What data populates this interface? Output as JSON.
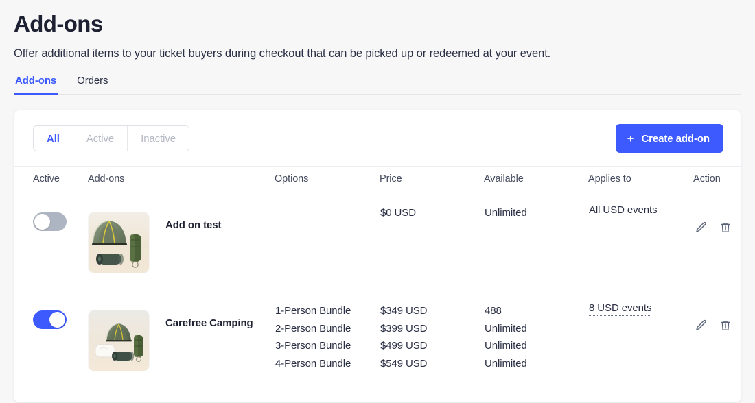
{
  "page": {
    "title": "Add-ons",
    "subtitle": "Offer additional items to your ticket buyers during checkout that can be picked up or redeemed at your event."
  },
  "tabs": [
    {
      "label": "Add-ons",
      "active": true
    },
    {
      "label": "Orders",
      "active": false
    }
  ],
  "toolbar": {
    "filters": [
      {
        "label": "All",
        "selected": true
      },
      {
        "label": "Active",
        "selected": false
      },
      {
        "label": "Inactive",
        "selected": false
      }
    ],
    "create_label": "Create add-on",
    "create_icon": "plus-icon",
    "plus_glyph": "+"
  },
  "table": {
    "headers": {
      "active": "Active",
      "addons": "Add-ons",
      "options": "Options",
      "price": "Price",
      "available": "Available",
      "applies_to": "Applies to",
      "action": "Action"
    },
    "rows": [
      {
        "active": false,
        "name": "Add on test",
        "thumbnail": "camping-gear-photo",
        "options": [],
        "prices": [
          "$0 USD"
        ],
        "available": [
          "Unlimited"
        ],
        "applies_to": "All USD events",
        "applies_to_link": false,
        "edit_icon": "pencil-icon",
        "delete_icon": "trash-icon"
      },
      {
        "active": true,
        "name": "Carefree Camping",
        "thumbnail": "camping-gear-wide-photo",
        "options": [
          "1-Person Bundle",
          "2-Person Bundle",
          "3-Person Bundle",
          "4-Person Bundle"
        ],
        "prices": [
          "$349 USD",
          "$399 USD",
          "$499 USD",
          "$549 USD"
        ],
        "available": [
          "488",
          "Unlimited",
          "Unlimited",
          "Unlimited"
        ],
        "applies_to": "8 USD events",
        "applies_to_link": true,
        "edit_icon": "pencil-icon",
        "delete_icon": "trash-icon"
      }
    ]
  },
  "colors": {
    "accent": "#3d5afe",
    "page_bg": "#f7f7f8",
    "card_bg": "#ffffff",
    "text": "#1e2132",
    "muted": "#b5b9c4",
    "toggle_off": "#aeb5c2",
    "divider": "#eceef1"
  }
}
